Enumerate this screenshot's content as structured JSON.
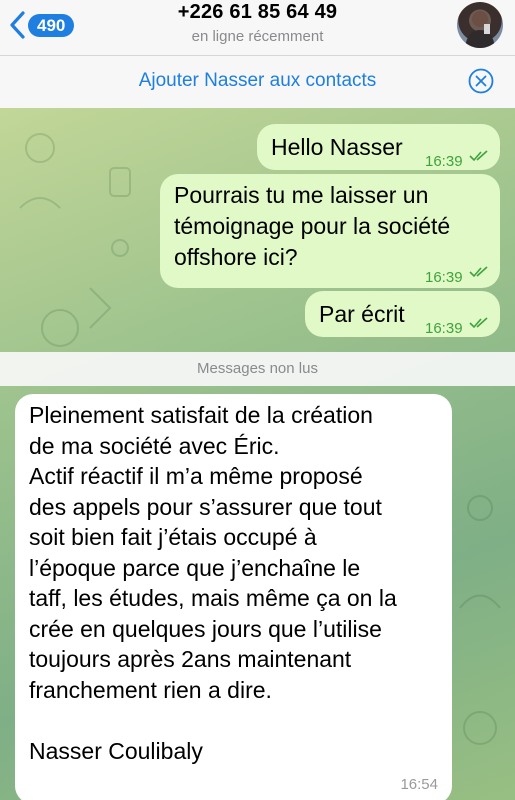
{
  "header": {
    "back_count": "490",
    "title": "+226 61 85 64 49",
    "status": "en ligne récemment",
    "avatar_icon": "user-avatar-icon"
  },
  "add_contact": {
    "label": "Ajouter Nasser aux contacts",
    "close_icon": "close-circle-icon"
  },
  "messages_out": [
    {
      "text": "Hello Nasser",
      "time": "16:39"
    },
    {
      "line1": "Pourrais tu me laisser un",
      "line2": "témoignage pour la société",
      "line3": "offshore ici?",
      "time": "16:39"
    },
    {
      "text": "Par écrit",
      "time": "16:39"
    }
  ],
  "unread_divider": "Messages non lus",
  "message_in": {
    "text": "Pleinement satisfait de la création\nde ma société avec Éric.\nActif réactif il m’a même proposé\ndes appels pour s’assurer que tout\nsoit bien fait j’étais occupé à\nl’époque parce que j’enchaîne le\ntaff, les études, mais même ça on la\ncrée en quelques jours que  l’utilise\ntoujours après 2ans maintenant\nfranchement rien a dire.\n\nNasser Coulibaly",
    "time": "16:54"
  },
  "colors": {
    "accent": "#1e7fe0",
    "outgoing_bubble": "#e1f8c7",
    "outgoing_time": "#3fa33d"
  }
}
